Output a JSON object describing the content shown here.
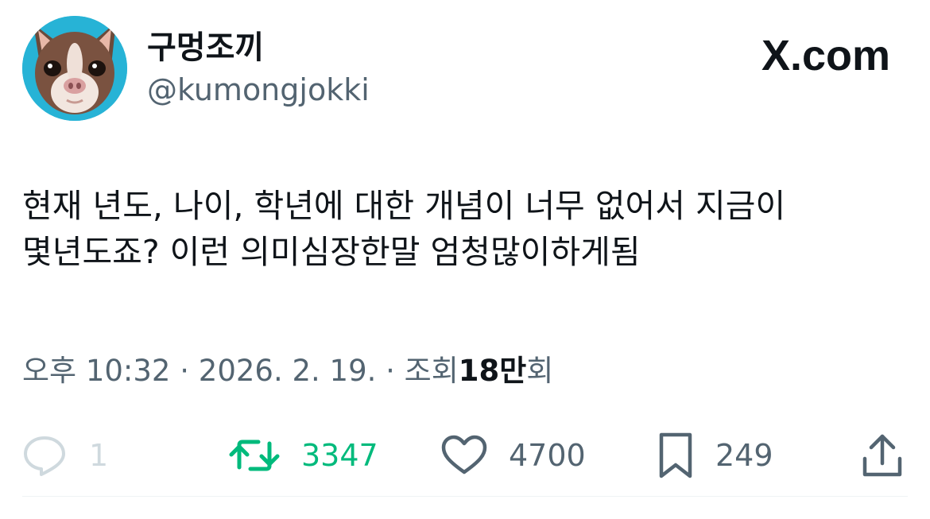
{
  "author": {
    "display_name": "구멍조끼",
    "handle": "@kumongjokki",
    "avatar": "chihuahua-avatar"
  },
  "brand": {
    "text": "X.com",
    "icon": "x-logo-icon"
  },
  "tweet": {
    "lines": [
      "현재 년도, 나이, 학년에 대한 개념이 너무 없어서  지금이",
      "몇년도죠? 이런 의미심장한말 엄청많이하게됨"
    ]
  },
  "meta": {
    "time": "오후 10:32",
    "date": "2026. 2. 19.",
    "separator": "·",
    "views_label": "조회",
    "views_count": "18만",
    "views_suffix": "회"
  },
  "actions": {
    "reply": {
      "icon": "reply-icon",
      "count": "1",
      "color": "#cfd9de"
    },
    "retweet": {
      "icon": "retweet-icon",
      "count": "3347",
      "color": "#00ba7c"
    },
    "like": {
      "icon": "heart-icon",
      "count": "4700",
      "color": "#536471"
    },
    "bookmark": {
      "icon": "bookmark-icon",
      "count": "249",
      "color": "#536471"
    },
    "share": {
      "icon": "share-icon",
      "color": "#536471"
    }
  }
}
